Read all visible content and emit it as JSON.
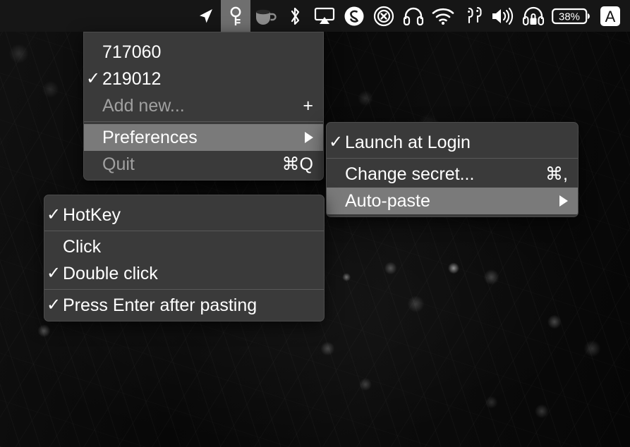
{
  "menubar": {
    "icons": [
      {
        "name": "location-arrow-icon",
        "label": "Location Services",
        "active": false
      },
      {
        "name": "key-icon",
        "label": "Password Manager",
        "active": true
      },
      {
        "name": "coffee-cup-icon",
        "label": "Caffeine",
        "active": false
      },
      {
        "name": "bluetooth-icon",
        "label": "Bluetooth",
        "active": false
      },
      {
        "name": "airplay-icon",
        "label": "Screen Mirroring",
        "active": false
      },
      {
        "name": "shazam-icon",
        "label": "Shazam",
        "active": false
      },
      {
        "name": "x-circle-icon",
        "label": "Cleaner",
        "active": false
      },
      {
        "name": "headphones-icon",
        "label": "Headphones",
        "active": false
      },
      {
        "name": "wifi-icon",
        "label": "Wi-Fi",
        "active": false
      },
      {
        "name": "airpods-icon",
        "label": "AirPods",
        "active": false
      },
      {
        "name": "volume-icon",
        "label": "Volume",
        "active": false
      },
      {
        "name": "headphones-lock-icon",
        "label": "Audio Lock",
        "active": false
      },
      {
        "name": "battery-icon",
        "label": "Battery",
        "active": false
      },
      {
        "name": "input-source-icon",
        "label": "Input Source",
        "active": false
      }
    ],
    "battery_percent": "38%",
    "input_source": "A"
  },
  "menu_main": {
    "groups": [
      {
        "items": [
          {
            "label": "717060",
            "checked": false,
            "dim": false,
            "selected": false,
            "accessory": ""
          },
          {
            "label": "219012",
            "checked": true,
            "dim": false,
            "selected": false,
            "accessory": ""
          },
          {
            "label": "Add new...",
            "checked": false,
            "dim": true,
            "selected": false,
            "accessory": "+"
          }
        ]
      },
      {
        "items": [
          {
            "label": "Preferences",
            "checked": false,
            "dim": false,
            "selected": true,
            "accessory": "submenu"
          },
          {
            "label": "Quit",
            "checked": false,
            "dim": true,
            "selected": false,
            "accessory": "⌘Q"
          }
        ]
      }
    ]
  },
  "menu_preferences": {
    "groups": [
      {
        "items": [
          {
            "label": "Launch at Login",
            "checked": true,
            "dim": false,
            "selected": false,
            "accessory": ""
          }
        ]
      },
      {
        "items": [
          {
            "label": "Change secret...",
            "checked": false,
            "dim": false,
            "selected": false,
            "accessory": "⌘,"
          },
          {
            "label": "Auto-paste",
            "checked": false,
            "dim": false,
            "selected": true,
            "accessory": "submenu"
          }
        ]
      }
    ]
  },
  "menu_autopaste": {
    "groups": [
      {
        "items": [
          {
            "label": "HotKey",
            "checked": true,
            "dim": false,
            "selected": false,
            "accessory": ""
          }
        ]
      },
      {
        "items": [
          {
            "label": "Click",
            "checked": false,
            "dim": false,
            "selected": false,
            "accessory": ""
          },
          {
            "label": "Double click",
            "checked": true,
            "dim": false,
            "selected": false,
            "accessory": ""
          }
        ]
      },
      {
        "items": [
          {
            "label": "Press Enter after pasting",
            "checked": true,
            "dim": false,
            "selected": false,
            "accessory": ""
          }
        ]
      }
    ]
  },
  "colors": {
    "menubar_bg": "#161616",
    "menu_bg": "#3a3a3a",
    "menu_selected_bg": "#7a7a7a",
    "menu_text": "#ffffff",
    "menu_text_dim": "#a0a0a0",
    "menubar_active_bg": "#6f6f6f"
  }
}
